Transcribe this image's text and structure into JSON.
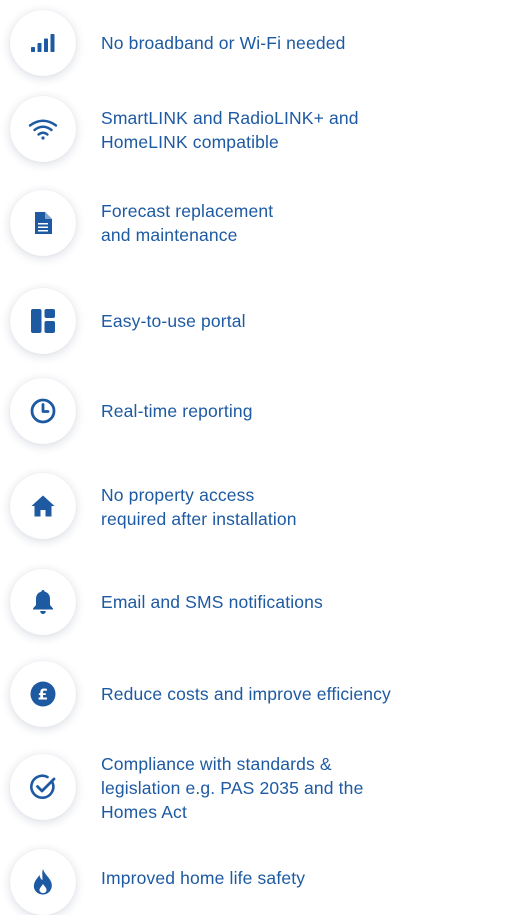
{
  "brand_color": "#1d5aa2",
  "features": [
    {
      "icon": "signal-bars-icon",
      "label": "No broadband or Wi-Fi needed"
    },
    {
      "icon": "wifi-icon",
      "label": "SmartLINK and RadioLINK+ and\nHomeLINK compatible"
    },
    {
      "icon": "document-icon",
      "label": "Forecast replacement\nand maintenance"
    },
    {
      "icon": "dashboard-icon",
      "label": "Easy-to-use portal"
    },
    {
      "icon": "clock-icon",
      "label": "Real-time reporting"
    },
    {
      "icon": "home-icon",
      "label": "No property access\nrequired after installation"
    },
    {
      "icon": "bell-icon",
      "label": "Email and SMS notifications"
    },
    {
      "icon": "pound-coin-icon",
      "label": "Reduce costs and improve efficiency"
    },
    {
      "icon": "check-circle-icon",
      "label": "Compliance with standards &\nlegislation e.g. PAS 2035 and the\nHomes Act"
    },
    {
      "icon": "flame-icon",
      "label": "Improved home life safety"
    }
  ]
}
